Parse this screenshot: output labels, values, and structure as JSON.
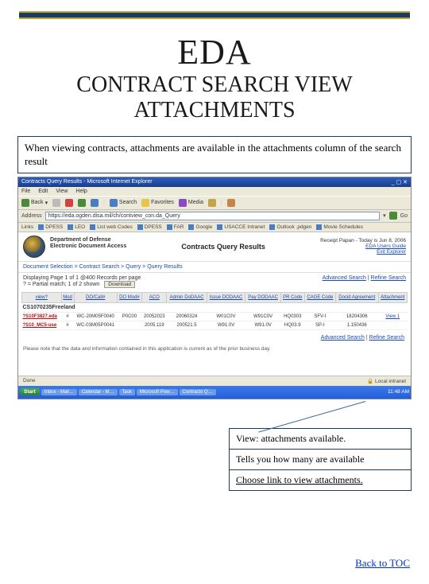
{
  "title": {
    "main": "EDA",
    "sub": "CONTRACT SEARCH VIEW ATTACHMENTS"
  },
  "description": "When viewing contracts, attachments are available in the attachments column of the search result",
  "browser": {
    "title": "Contracts Query Results - Microsoft Internet Explorer",
    "menu": [
      "File",
      "Edit",
      "View",
      "Help"
    ],
    "toolbar": {
      "back": "Back",
      "search": "Search",
      "favorites": "Favorites",
      "media": "Media"
    },
    "addressLabel": "Address",
    "url": "https://eda.ogden.disa.mil/ch/contview_con.da_Query",
    "go": "Go",
    "linksLabel": "Links",
    "links": [
      "DPESS",
      "LEO",
      "List web Codes",
      "DPESS",
      "FAR",
      "Google",
      "USACCE Intranet",
      "Outlook .pdgen",
      "Movie Schedules"
    ]
  },
  "page": {
    "dept": "Department of Defense",
    "system": "Electronic Document Access",
    "title": "Contracts Query Results",
    "userLabel": "Receipt Papan - Today is Jun 8, 2006",
    "userGuide": "EDA Users Guide",
    "exit": "Exit Explorer",
    "breadcrumb": "Document Selection > Contract Search > Query > Query Results",
    "displaying": "Displaying Page 1 of 1 @400 Records per page",
    "matched": "? = Partial match; 1 of 2 shown",
    "download": "Download",
    "advanced": "Advanced Search",
    "refine": "Refine Search",
    "section": "CS1070235Freeland",
    "headers": [
      "view?",
      "Mod",
      "DO/Call#",
      "DO Mod#",
      "ACO",
      "Admin DoDAAC",
      "Issue DODAAC",
      "Pay DODAAC",
      "PR Code",
      "CAGE Code",
      "Docid Agreement",
      "Attachment"
    ],
    "rows": [
      {
        "v": "?S10F3827.eda",
        "c": [
          "#",
          "WC-20M05F0040",
          "P0C00",
          "20052023",
          "20060324",
          "W01C0V",
          "W91C0V",
          "HQ0303",
          "SFV-I",
          "18204306",
          "",
          "View 1"
        ]
      },
      {
        "v": "?S10_MC5-use",
        "c": [
          "#",
          "WC-03M05P0041",
          "",
          "2005.119",
          "200521.5",
          "W91.0V",
          "W91.0V",
          "HQ03.9",
          "SP-I",
          "1.150436",
          "",
          ""
        ]
      }
    ],
    "footerNote": "Please note that the data and information contained in this application is current as of the prior business day."
  },
  "statusbar": {
    "done": "Done",
    "intranet": "Local intranet"
  },
  "taskbar": {
    "start": "Start",
    "items": [
      "Inbox - Mail…",
      "Calendar - M…",
      "Task",
      "Microsoft Pow…",
      "Contracts Q…"
    ],
    "time": "11:48 AM"
  },
  "callout": {
    "line1": "View: attachments available.",
    "line2": "Tells you how many are available",
    "line3": "Choose link to view attachments."
  },
  "backLink": "Back to TOC"
}
